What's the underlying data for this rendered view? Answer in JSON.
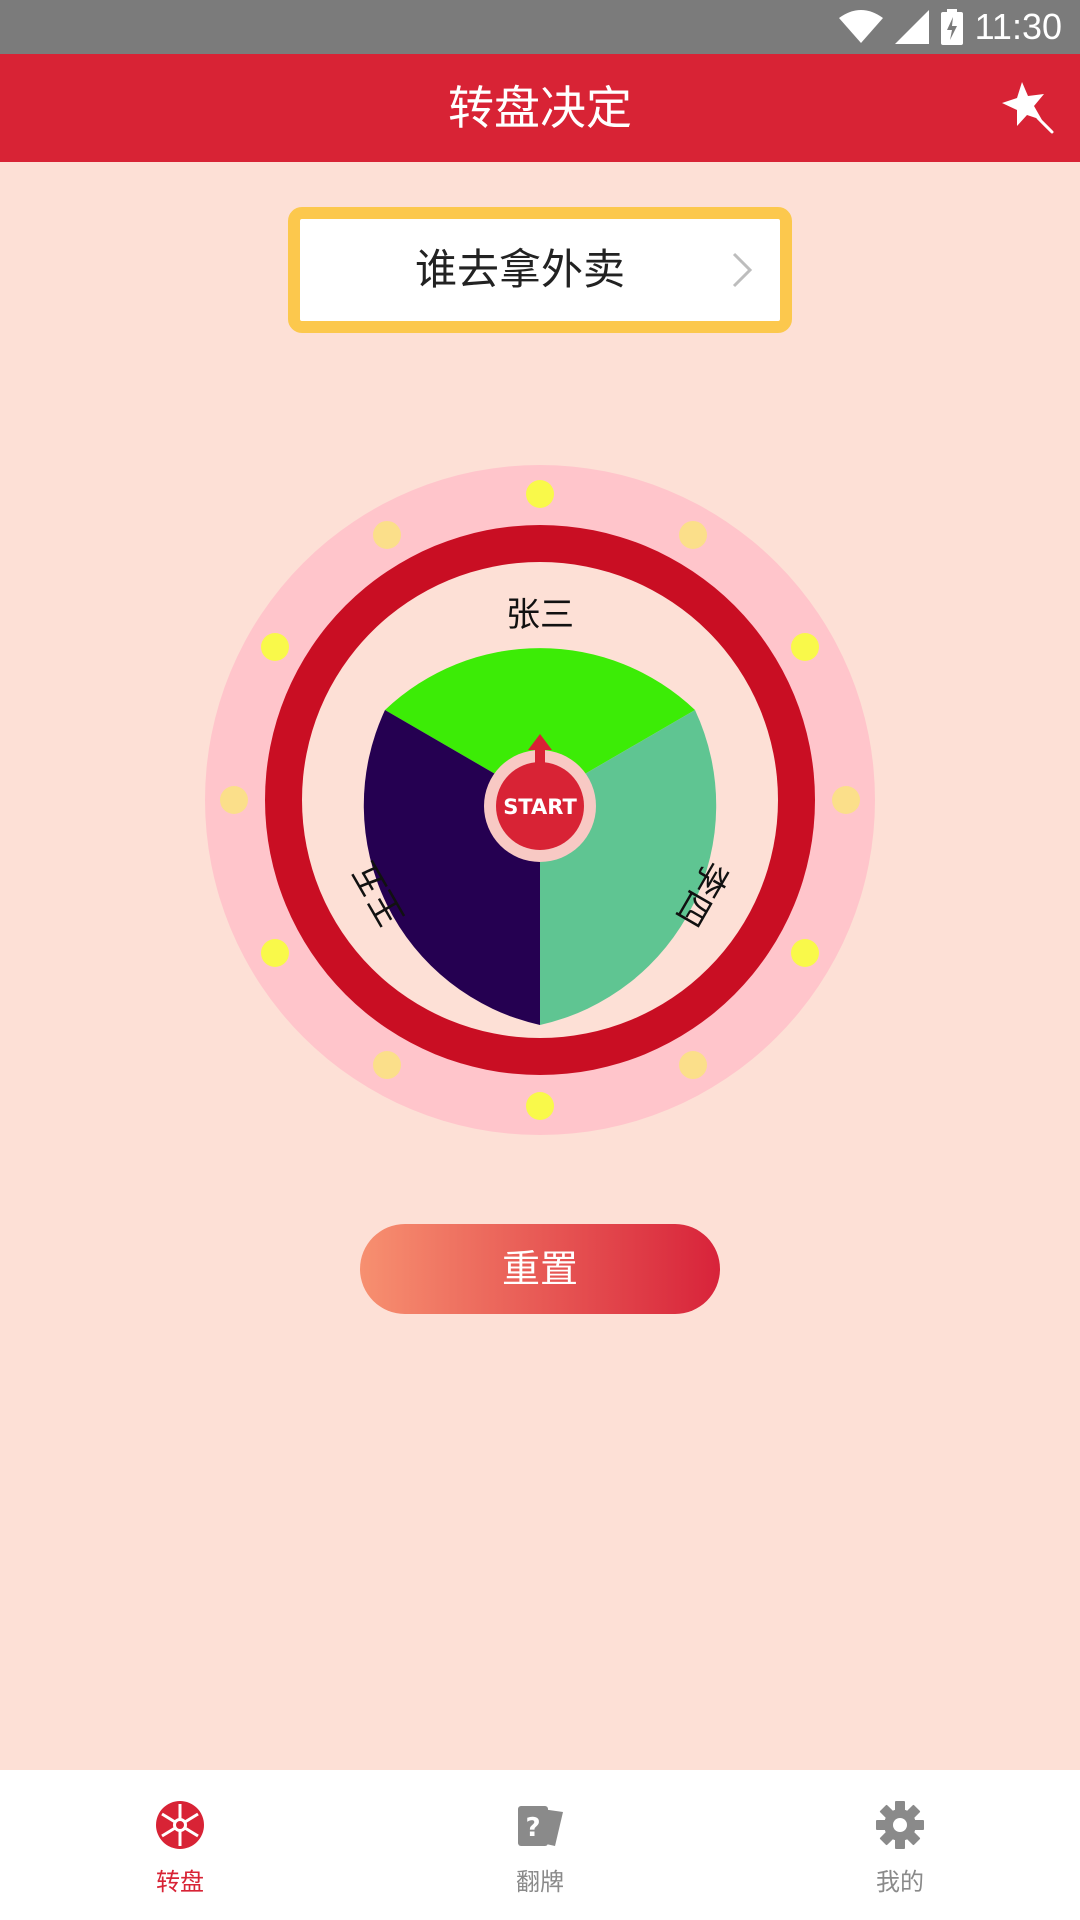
{
  "status_bar": {
    "time": "11:30",
    "icons": [
      "wifi-icon",
      "signal-icon",
      "battery-charging-icon"
    ]
  },
  "app_bar": {
    "title": "转盘决定",
    "action_icon": "star-wand-icon"
  },
  "topic": {
    "label": "谁去拿外卖"
  },
  "wheel": {
    "segments": [
      {
        "label": "张三",
        "color": "#3cec06"
      },
      {
        "label": "李四",
        "color": "#5fc592"
      },
      {
        "label": "王五",
        "color": "#250051"
      }
    ],
    "start_label": "START",
    "colors": {
      "outer_ring": "#ffc5cb",
      "red_ring": "#c90e23",
      "inner_ring": "#fde0d6",
      "bulb_bright": "#f9f94a",
      "bulb_dim": "#fbdf8a"
    }
  },
  "reset_button": {
    "label": "重置"
  },
  "bottom_nav": {
    "items": [
      {
        "label": "转盘",
        "icon": "wheel-icon",
        "active": true
      },
      {
        "label": "翻牌",
        "icon": "question-card-icon",
        "active": false
      },
      {
        "label": "我的",
        "icon": "gear-icon",
        "active": false
      }
    ],
    "active_color": "#d82335",
    "inactive_color": "#8a8a8a"
  }
}
